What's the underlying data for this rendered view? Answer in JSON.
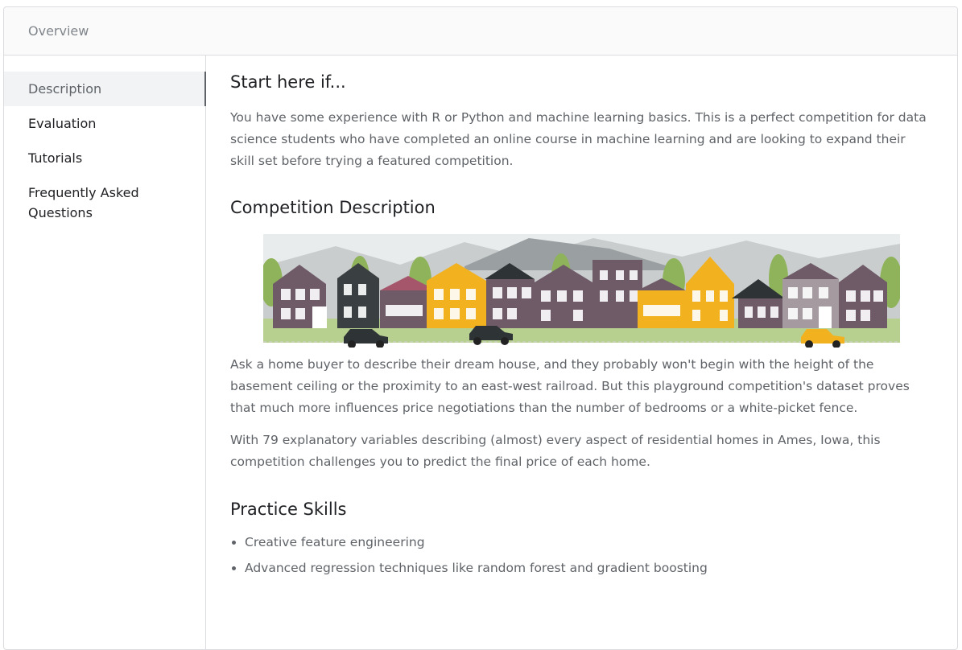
{
  "header": {
    "title": "Overview"
  },
  "sidebar": {
    "items": [
      {
        "label": "Description"
      },
      {
        "label": "Evaluation"
      },
      {
        "label": "Tutorials"
      },
      {
        "label": "Frequently Asked Questions"
      }
    ]
  },
  "main": {
    "start_heading": "Start here if...",
    "start_text": "You have some experience with R or Python and machine learning basics. This is a perfect competition for data science students who have completed an online course in machine learning and are looking to expand their skill set before trying a featured competition.",
    "competition_heading": "Competition Description",
    "competition_text_1": "Ask a home buyer to describe their dream house, and they probably won't begin with the height of the basement ceiling or the proximity to an east-west railroad. But this playground competition's dataset proves that much more influences price negotiations than the number of bedrooms or a white-picket fence.",
    "competition_text_2": "With 79 explanatory variables describing (almost) every aspect of residential homes in Ames, Iowa, this competition challenges you to predict the final price of each home.",
    "skills_heading": "Practice Skills",
    "skills": [
      "Creative feature engineering",
      "Advanced regression techniques like random forest and gradient boosting"
    ]
  },
  "colors": {
    "house_purple": "#6f5a67",
    "house_yellow": "#f2b11f",
    "house_dark": "#2e3436",
    "grass": "#b7cf8f",
    "mountain": "#9aa0a2"
  }
}
